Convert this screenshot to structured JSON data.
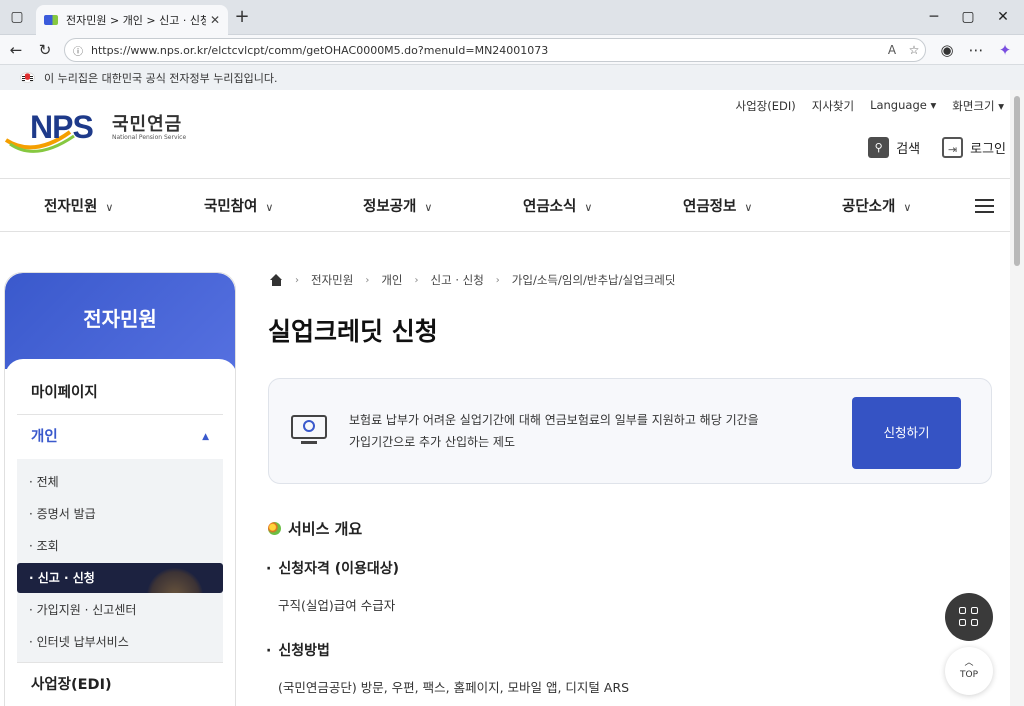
{
  "browser": {
    "tab_title": "전자민원 > 개인 > 신고 · 신청 >",
    "url": "https://www.nps.or.kr/elctcvlcpt/comm/getOHAC0000M5.do?menuId=MN24001073"
  },
  "gov_notice": "이 누리집은 대한민국 공식 전자정부 누리집입니다.",
  "header": {
    "logo_text": "NPS",
    "logo_kor": "국민연금",
    "logo_eng": "National Pension Service",
    "util": [
      "사업장(EDI)",
      "지사찾기",
      "Language ▾",
      "화면크기 ▾"
    ],
    "search_label": "검색",
    "login_label": "로그인"
  },
  "gnb": [
    "전자민원",
    "국민참여",
    "정보공개",
    "연금소식",
    "연금정보",
    "공단소개"
  ],
  "lnb": {
    "title": "전자민원",
    "d1": [
      "마이페이지",
      "개인",
      "사업장(EDI)"
    ],
    "sub": [
      "· 전체",
      "· 증명서 발급",
      "· 조회",
      "· 신고 · 신청",
      "· 가입지원 · 신고센터",
      "· 인터넷 납부서비스"
    ]
  },
  "breadcrumb": [
    "전자민원",
    "개인",
    "신고 · 신청",
    "가입/소득/임의/반추납/실업크레딧"
  ],
  "page_title": "실업크레딧 신청",
  "info_box": {
    "line1": "보험료 납부가 어려운 실업기간에 대해 연금보험료의 일부를 지원하고 해당 기간을",
    "line2": "가입기간으로 추가 산입하는 제도",
    "button": "신청하기"
  },
  "section_title": "서비스 개요",
  "eligibility": {
    "heading": "신청자격 (이용대상)",
    "text": "구직(실업)급여 수급자"
  },
  "method": {
    "heading": "신청방법",
    "text": "(국민연금공단) 방문, 우편, 팩스, 홈페이지, 모바일 앱, 디지털 ARS"
  },
  "top_label": "TOP"
}
